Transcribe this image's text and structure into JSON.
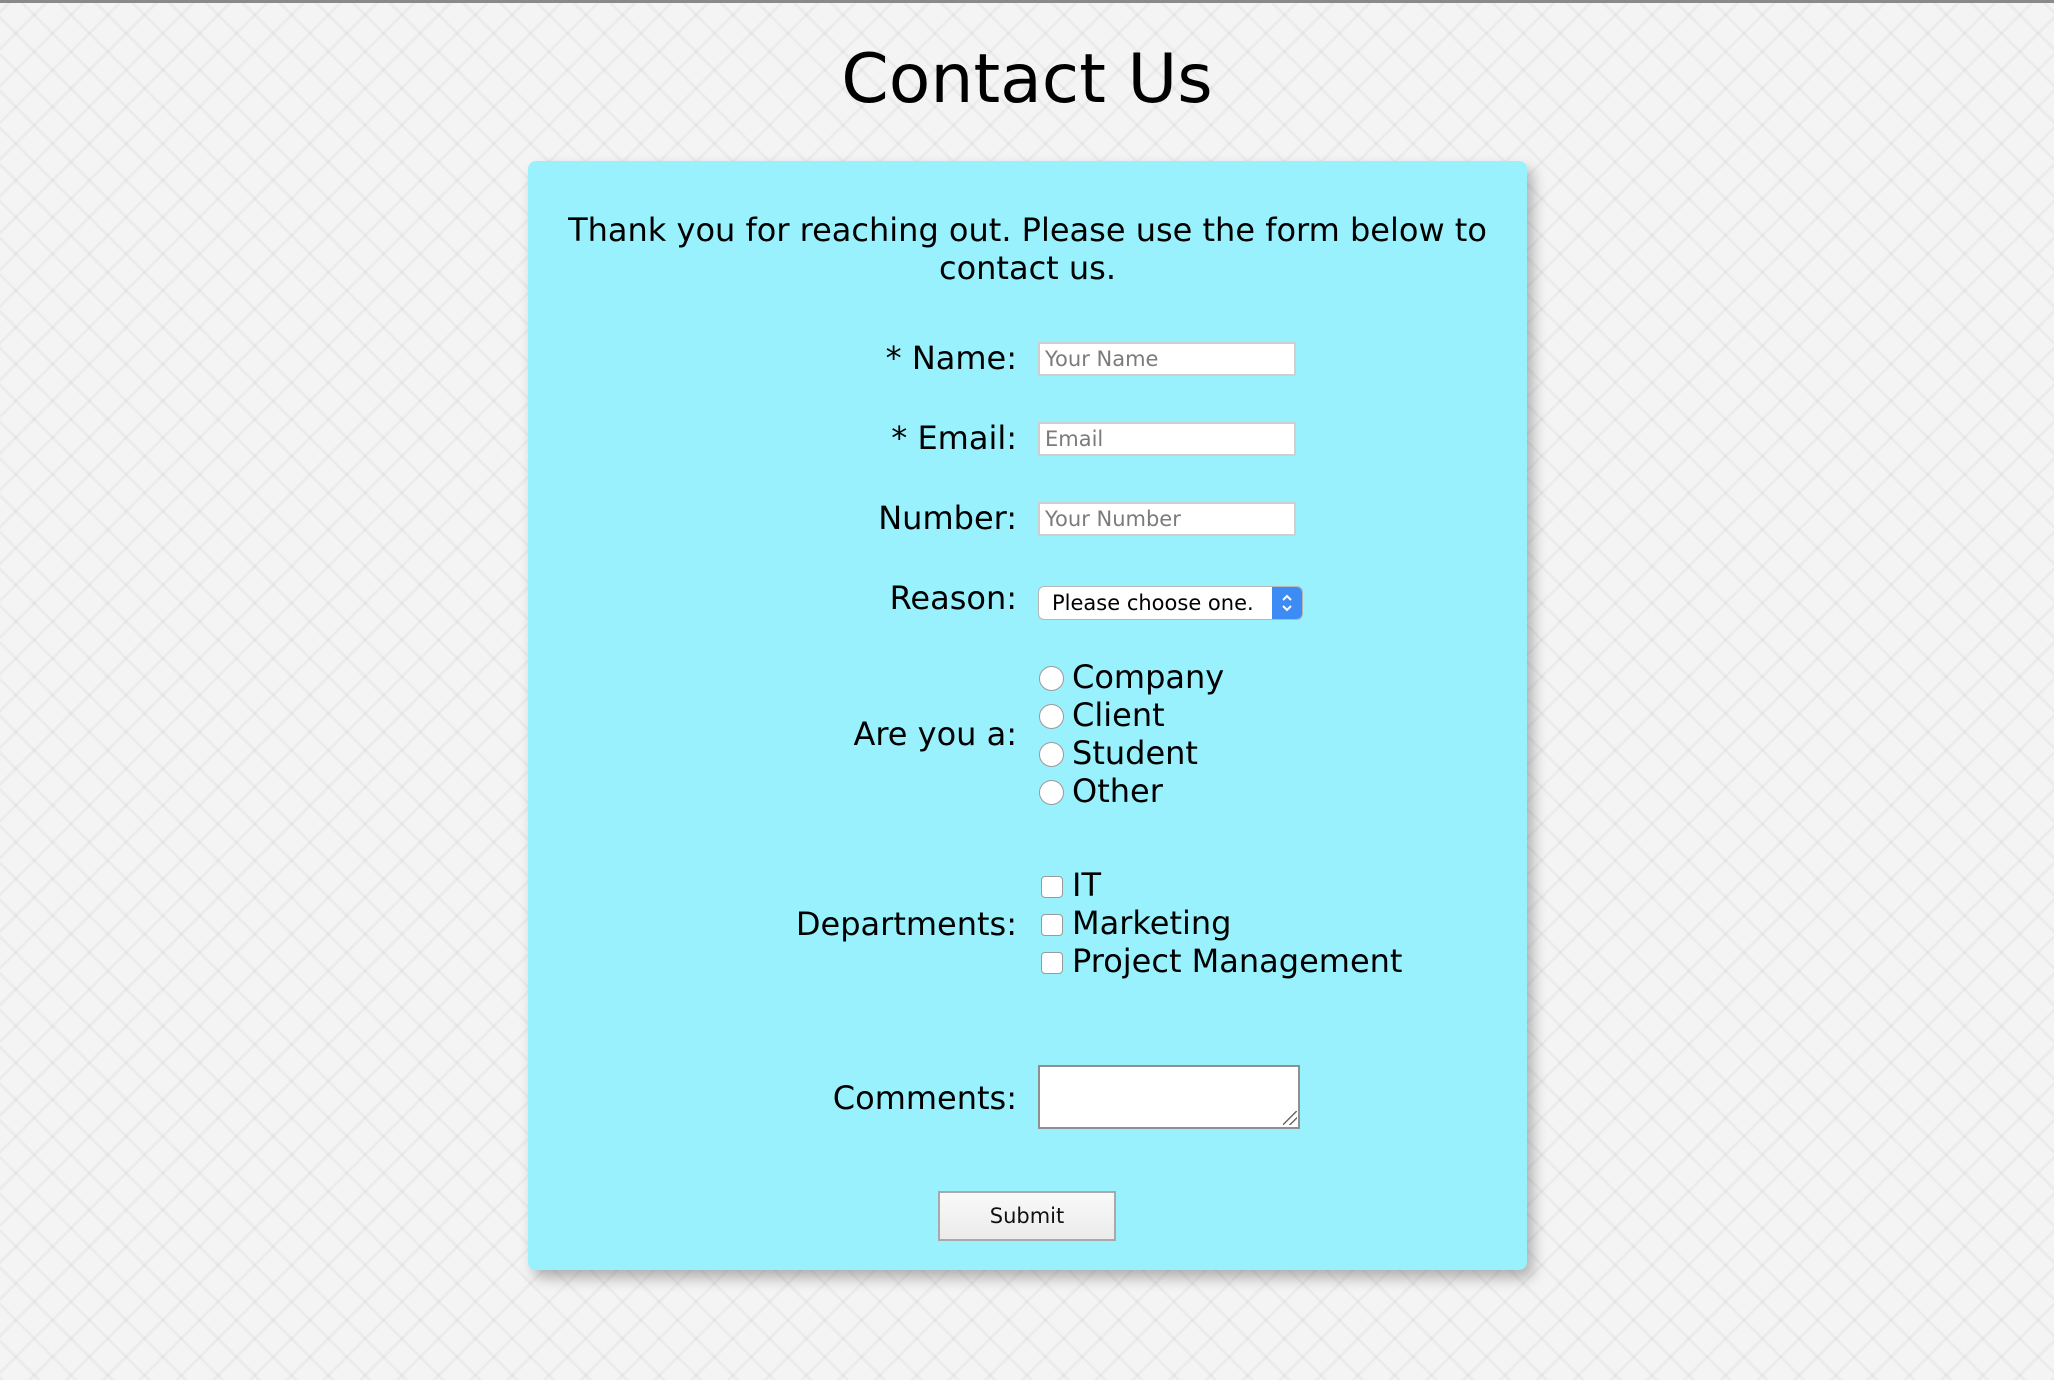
{
  "page": {
    "title": "Contact Us",
    "intro": "Thank you for reaching out. Please use the form below to contact us."
  },
  "form": {
    "name": {
      "label": "* Name:",
      "placeholder": "Your Name",
      "value": ""
    },
    "email": {
      "label": "* Email:",
      "placeholder": "Email",
      "value": ""
    },
    "number": {
      "label": "Number:",
      "placeholder": "Your Number",
      "value": ""
    },
    "reason": {
      "label": "Reason:",
      "selected": "Please choose one."
    },
    "role": {
      "label": "Are you a:",
      "options": [
        {
          "label": "Company",
          "checked": false
        },
        {
          "label": "Client",
          "checked": false
        },
        {
          "label": "Student",
          "checked": false
        },
        {
          "label": "Other",
          "checked": false
        }
      ]
    },
    "departments": {
      "label": "Departments:",
      "options": [
        {
          "label": "IT",
          "checked": false
        },
        {
          "label": "Marketing",
          "checked": false
        },
        {
          "label": "Project Management",
          "checked": false
        }
      ]
    },
    "comments": {
      "label": "Comments:",
      "value": ""
    },
    "submit_label": "Submit"
  },
  "colors": {
    "card_background": "#98f1fc",
    "page_background": "#f4f4f5",
    "select_accent": "#3d8cf5"
  }
}
